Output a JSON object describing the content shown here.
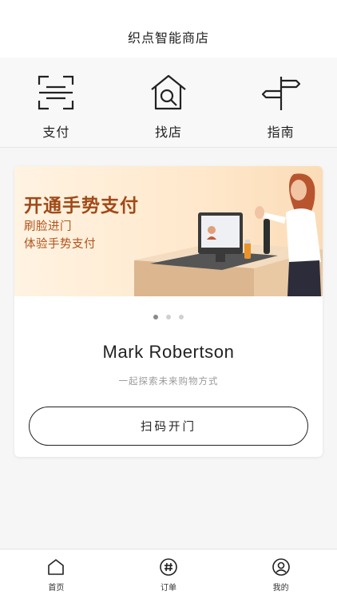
{
  "header": {
    "title": "织点智能商店"
  },
  "quick_actions": [
    {
      "label": "支付",
      "icon": "scan-pay-icon"
    },
    {
      "label": "找店",
      "icon": "store-search-icon"
    },
    {
      "label": "指南",
      "icon": "signpost-icon"
    }
  ],
  "banner": {
    "title": "开通手势支付",
    "line1": "刷脸进门",
    "line2": "体验手势支付"
  },
  "carousel": {
    "count": 3,
    "active": 0
  },
  "user": {
    "name": "Mark Robertson"
  },
  "slogan": "一起探索未来购物方式",
  "scan_button": {
    "label": "扫码开门"
  },
  "tabbar": [
    {
      "label": "首页",
      "icon": "home-icon"
    },
    {
      "label": "订单",
      "icon": "order-icon"
    },
    {
      "label": "我的",
      "icon": "profile-icon"
    }
  ]
}
